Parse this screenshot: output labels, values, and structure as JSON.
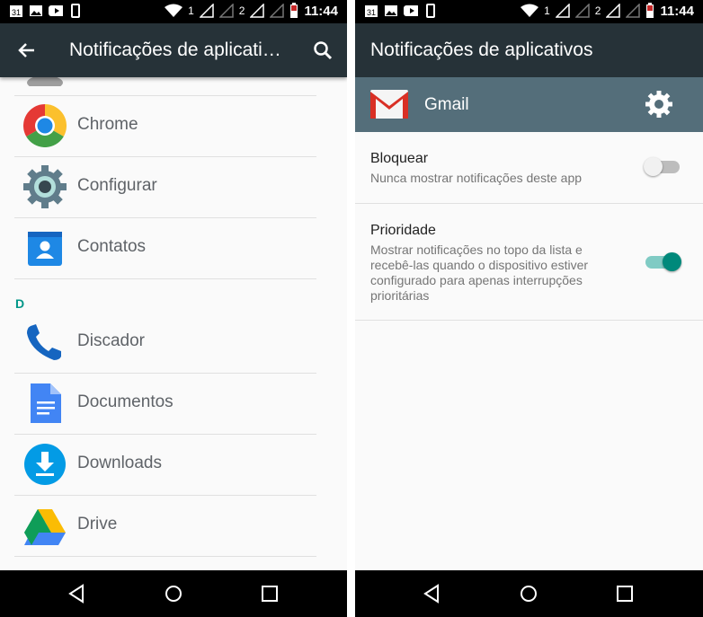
{
  "status_bar": {
    "time": "11:44",
    "sim1": "1",
    "sim2": "2",
    "calendar_day": "31"
  },
  "left": {
    "title": "Notificações de aplicati…",
    "section_letter": "D",
    "apps": [
      {
        "name": "Chrome",
        "icon": "chrome-icon"
      },
      {
        "name": "Configurar",
        "icon": "settings-gear-icon"
      },
      {
        "name": "Contatos",
        "icon": "contacts-icon"
      },
      {
        "name": "Discador",
        "icon": "phone-icon"
      },
      {
        "name": "Documentos",
        "icon": "docs-icon"
      },
      {
        "name": "Downloads",
        "icon": "download-icon"
      },
      {
        "name": "Drive",
        "icon": "drive-icon"
      }
    ]
  },
  "right": {
    "title": "Notificações de aplicativos",
    "app_name": "Gmail",
    "settings": [
      {
        "title": "Bloquear",
        "subtitle": "Nunca mostrar notificações deste app",
        "enabled": false
      },
      {
        "title": "Prioridade",
        "subtitle_lines": [
          "Mostrar notificações no topo da lista e",
          "recebê-las quando o dispositivo estiver",
          "configurado para apenas interrupções",
          "prioritárias"
        ],
        "enabled": true
      }
    ]
  },
  "colors": {
    "appbar": "#263238",
    "gmail_header": "#546e7a",
    "accent": "#009688",
    "toggle_on_track": "#80cbc4",
    "toggle_off_track": "#bdbdbd"
  }
}
